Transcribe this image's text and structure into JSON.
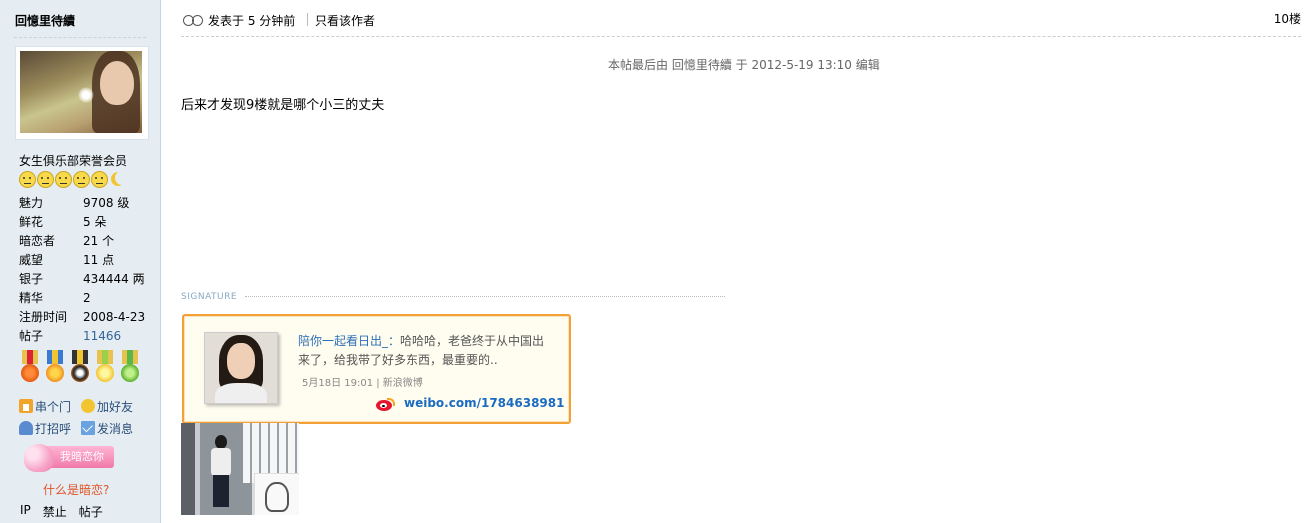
{
  "user": {
    "name": "回憶里待續",
    "group": "女生俱乐部荣誉会员",
    "stats": [
      {
        "label": "魅力",
        "value": "9708 级"
      },
      {
        "label": "鲜花",
        "value": "5 朵"
      },
      {
        "label": "暗恋者",
        "value": "21 个"
      },
      {
        "label": "威望",
        "value": "11 点"
      },
      {
        "label": "银子",
        "value": "434444 两"
      },
      {
        "label": "精华",
        "value": "2"
      },
      {
        "label": "注册时间",
        "value": "2008-4-23"
      },
      {
        "label": "帖子",
        "value": "11466"
      }
    ],
    "actions": {
      "visit": "串个门",
      "add_friend": "加好友",
      "greet": "打招呼",
      "message": "发消息"
    },
    "crush_button": "我暗恋你",
    "crush_link": "什么是暗恋?",
    "bottom_links": [
      "IP",
      "禁止",
      "帖子"
    ]
  },
  "post": {
    "posted": "发表于 5 分钟前",
    "only_author": "只看该作者",
    "floor": "10楼",
    "edit_note": "本帖最后由 回憶里待續 于 2012-5-19 13:10 编辑",
    "body": "后来才发现9楼就是哪个小三的丈夫",
    "signature_label": "SIGNATURE"
  },
  "weibo": {
    "user": "陪你一起看日出_",
    "colon": "：",
    "text": "哈哈哈，老爸终于从中国出来了，给我带了好多东西，最重要的..",
    "meta": "5月18日 19:01 | 新浪微博",
    "url": "weibo.com/1784638981"
  },
  "colors": {
    "sidebar_bg": "#e5edf2",
    "card_border": "#f3a037",
    "link": "#336699",
    "weibo_blue": "#1a6bc1"
  }
}
